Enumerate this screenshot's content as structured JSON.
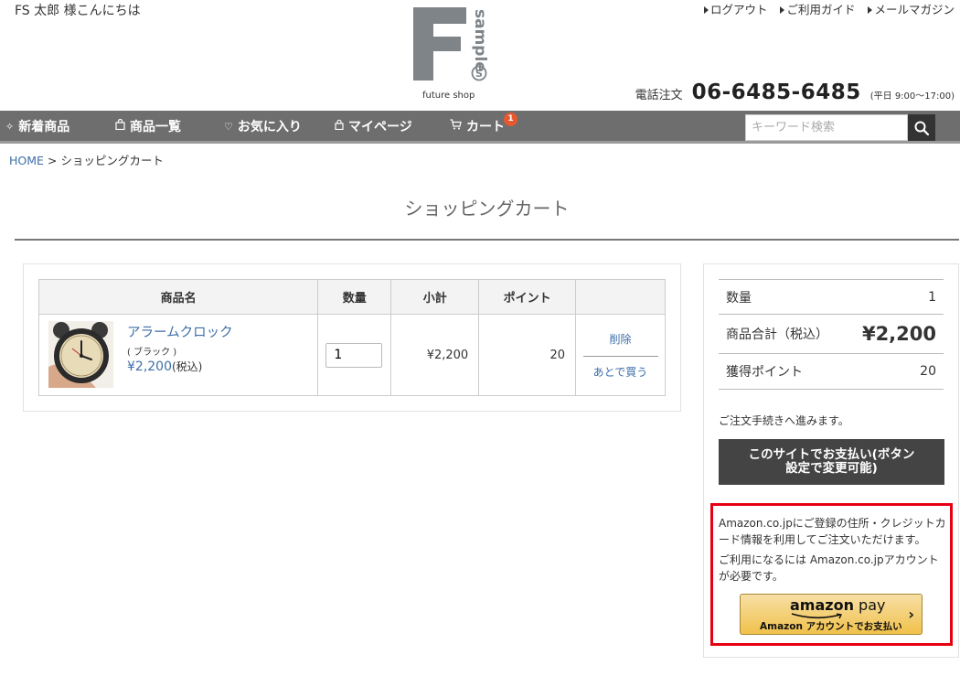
{
  "header": {
    "greeting": "FS 太郎 様こんにちは",
    "links": [
      "ログアウト",
      "ご利用ガイド",
      "メールマガジン"
    ],
    "logo_letter": "F",
    "logo_word": "sample",
    "logo_badge": "S",
    "logo_sub": "future shop",
    "tel_label": "電話注文",
    "tel_number": "06-6485-6485",
    "tel_hours": "(平日 9:00〜17:00)"
  },
  "nav": {
    "items": [
      {
        "label": "新着商品",
        "icon": "sparkle-icon"
      },
      {
        "label": "商品一覧",
        "icon": "bag-icon"
      },
      {
        "label": "お気に入り",
        "icon": "heart-icon"
      },
      {
        "label": "マイページ",
        "icon": "lock-icon"
      },
      {
        "label": "カート",
        "icon": "cart-icon"
      }
    ],
    "cart_count": "1",
    "search_placeholder": "キーワード検索",
    "search_value": ""
  },
  "breadcrumb": {
    "home": "HOME",
    "sep": " > ",
    "current": "ショッピングカート"
  },
  "page_title": "ショッピングカート",
  "cart": {
    "headers": [
      "商品名",
      "数量",
      "小計",
      "ポイント",
      ""
    ],
    "items": [
      {
        "name": "アラームクロック",
        "variant": "( ブラック )",
        "price": "¥2,200",
        "tax": "(税込)",
        "quantity": "1",
        "subtotal": "¥2,200",
        "points": "20",
        "delete_label": "削除",
        "later_label": "あとで買う"
      }
    ]
  },
  "summary": {
    "qty_label": "数量",
    "qty_value": "1",
    "total_label": "商品合計（税込）",
    "total_value": "¥2,200",
    "points_label": "獲得ポイント",
    "points_value": "20",
    "note": "ご注文手続きへ進みます。",
    "checkout_line1": "このサイトでお支払い(ボタン",
    "checkout_line2": "設定で変更可能)"
  },
  "amazon": {
    "text1": "Amazon.co.jpにご登録の住所・クレジットカード情報を利用してご注文いただけます。",
    "text2": "ご利用になるには Amazon.co.jpアカウントが必要です。",
    "logo_amazon": "amazon",
    "logo_pay": " pay",
    "sub": "Amazon アカウントでお支払い",
    "chevron": "›"
  },
  "colors": {
    "nav_bg": "#6e6e6e",
    "link": "#3d6ea8",
    "badge": "#e8582e",
    "highlight_border": "#e60012",
    "checkout_bg": "#444444",
    "amazon_button": "#f0c14b"
  }
}
